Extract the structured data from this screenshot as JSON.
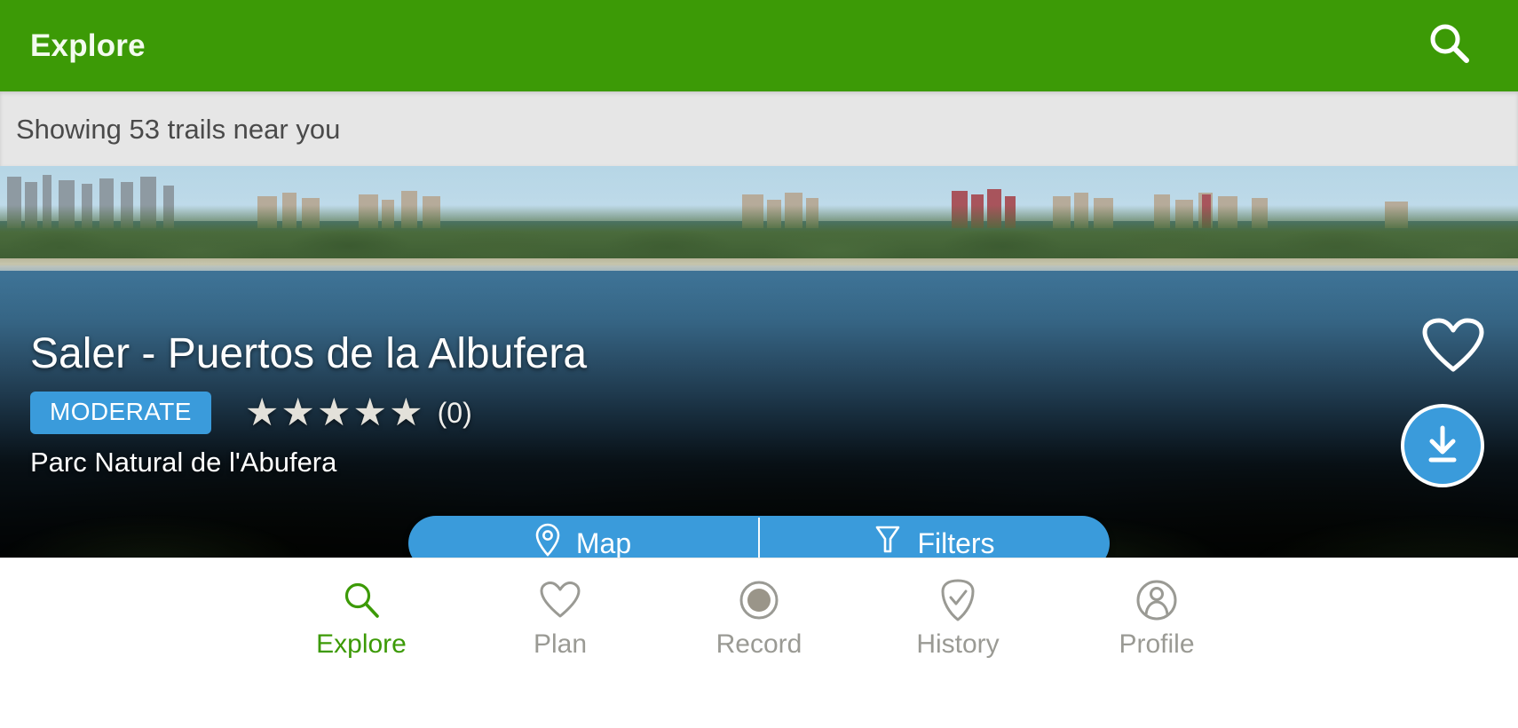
{
  "appbar": {
    "title": "Explore",
    "search_icon": "search-icon"
  },
  "statusbar": {
    "text": "Showing 53 trails near you",
    "count": 53
  },
  "trail_card": {
    "title": "Saler - Puertos de la Albufera",
    "difficulty": "MODERATE",
    "difficulty_color": "#3a9bdb",
    "rating_stars": 5,
    "rating_filled": 0,
    "rating_count_label": "(0)",
    "subtitle": "Parc Natural de l'Abufera",
    "favorite_icon": "heart-outline-icon",
    "download_icon": "download-icon"
  },
  "action_pill": {
    "map_label": "Map",
    "map_icon": "map-pin-icon",
    "filters_label": "Filters",
    "filters_icon": "funnel-icon",
    "background_color": "#3a9bdb"
  },
  "bottom_nav": {
    "active_color": "#3c9a06",
    "inactive_color": "#9a9a94",
    "items": [
      {
        "label": "Explore",
        "icon": "search-icon",
        "active": true
      },
      {
        "label": "Plan",
        "icon": "heart-outline-icon",
        "active": false
      },
      {
        "label": "Record",
        "icon": "record-circle-icon",
        "active": false
      },
      {
        "label": "History",
        "icon": "shield-check-icon",
        "active": false
      },
      {
        "label": "Profile",
        "icon": "person-icon",
        "active": false
      }
    ]
  },
  "theme": {
    "header_green": "#3c9a06",
    "status_gray": "#e6e6e6",
    "accent_blue": "#3a9bdb"
  }
}
